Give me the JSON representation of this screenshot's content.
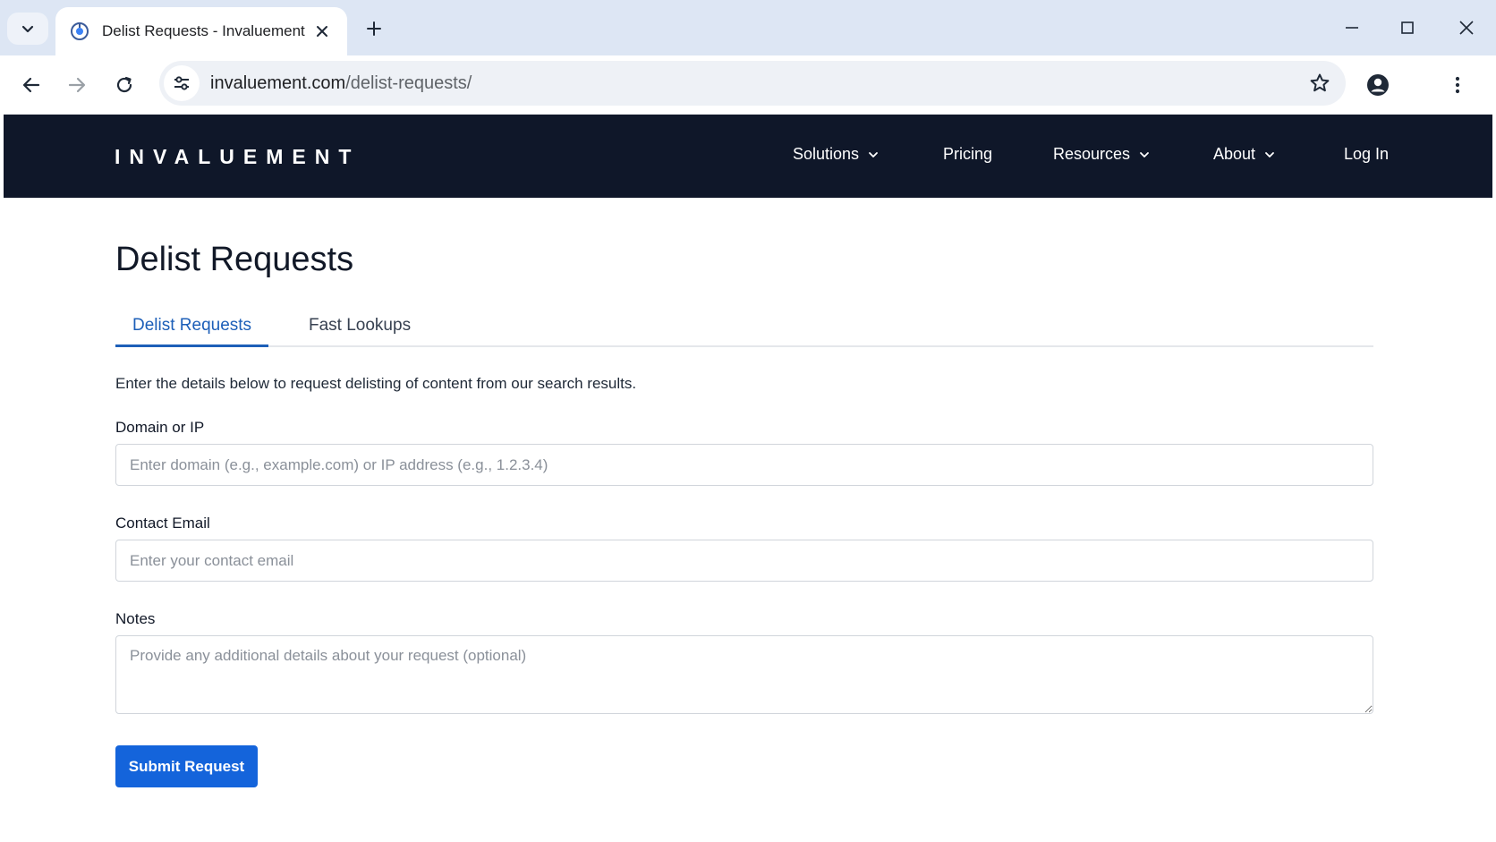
{
  "browser": {
    "tab_title": "Delist Requests - Invaluement",
    "url_host": "invaluement.com",
    "url_path": "/delist-requests/"
  },
  "site": {
    "logo": "INVALUEMENT",
    "nav": {
      "solutions": "Solutions",
      "pricing": "Pricing",
      "resources": "Resources",
      "about": "About",
      "login": "Log In"
    }
  },
  "page": {
    "title": "Delist Requests",
    "tabs": [
      {
        "label": "Delist Requests",
        "active": true
      },
      {
        "label": "Fast Lookups",
        "active": false
      }
    ],
    "description": "Enter the details below to request delisting of content from our search results.",
    "form": {
      "domain": {
        "label": "Domain or IP",
        "placeholder": "Enter domain (e.g., example.com) or IP address (e.g., 1.2.3.4)",
        "value": ""
      },
      "email": {
        "label": "Contact Email",
        "placeholder": "Enter your contact email",
        "value": ""
      },
      "notes": {
        "label": "Notes",
        "placeholder": "Provide any additional details about your request (optional)",
        "value": ""
      },
      "submit_label": "Submit Request"
    }
  },
  "icons": {
    "tab_list": "chevron-down-icon",
    "favicon": "invaluement-favicon-icon",
    "tab_close": "close-icon",
    "new_tab": "plus-icon",
    "minimize": "minimize-icon",
    "maximize": "maximize-icon",
    "window_close": "close-icon",
    "back": "arrow-left-icon",
    "forward": "arrow-right-icon",
    "reload": "reload-icon",
    "site_info": "tune-icon",
    "bookmark": "star-icon",
    "profile": "account-circle-icon",
    "menu": "more-vert-icon"
  },
  "colors": {
    "navbar_bg": "#0f1729",
    "accent": "#1d5fb8",
    "button_bg": "#1464db",
    "tabstrip_bg": "#dde6f4"
  }
}
